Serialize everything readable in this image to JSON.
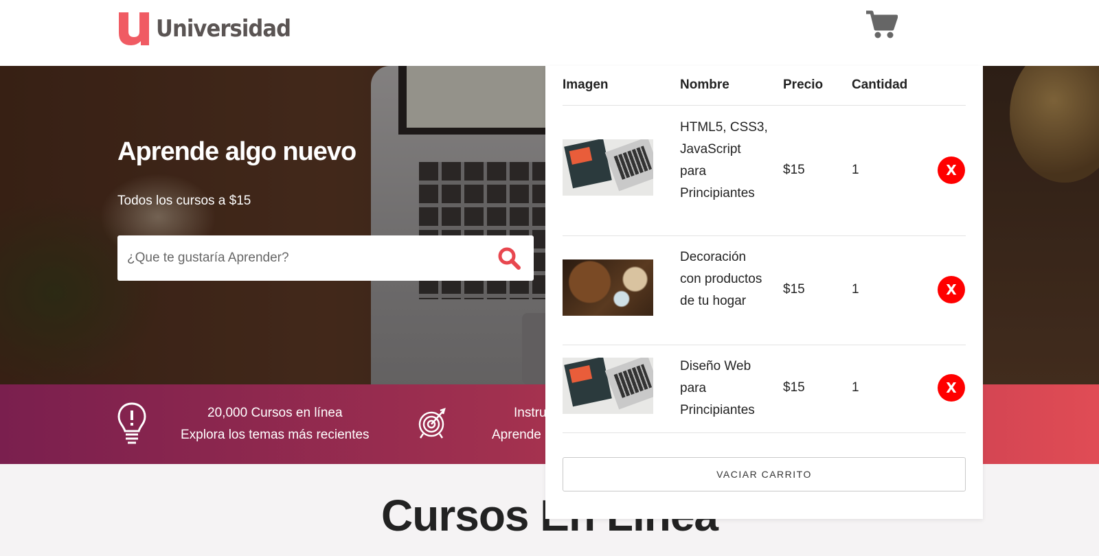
{
  "header": {
    "logo_text": "Universidad",
    "logo_letter": "u",
    "brand_color": "#f05b63",
    "cart_icon": "shopping-cart-icon"
  },
  "hero": {
    "title": "Aprende algo nuevo",
    "subtitle": "Todos los cursos a $15",
    "search_placeholder": "¿Que te gustaría Aprender?",
    "search_icon": "search-icon",
    "search_icon_color": "#e8474f"
  },
  "info_bar": {
    "items": [
      {
        "icon": "lightbulb-icon",
        "line1": "20,000 Cursos en línea",
        "line2": "Explora los temas más recientes"
      },
      {
        "icon": "target-icon",
        "line1": "Instru",
        "line2": "Aprende"
      }
    ]
  },
  "section": {
    "title": "Cursos En Línea"
  },
  "cart": {
    "headers": {
      "image": "Imagen",
      "name": "Nombre",
      "price": "Precio",
      "qty": "Cantidad"
    },
    "items": [
      {
        "name": "HTML5, CSS3, JavaScript para Principiantes",
        "price": "$15",
        "qty": "1",
        "delete_label": "X",
        "thumb": "laptop-books-image"
      },
      {
        "name": "Decoración con productos de tu hogar",
        "price": "$15",
        "qty": "1",
        "delete_label": "X",
        "thumb": "pinecones-cinnamon-image"
      },
      {
        "name": "Diseño Web para Principiantes",
        "price": "$15",
        "qty": "1",
        "delete_label": "X",
        "thumb": "laptop-books-image"
      }
    ],
    "empty_button": "VACIAR CARRITO",
    "delete_color": "#ff0000"
  }
}
